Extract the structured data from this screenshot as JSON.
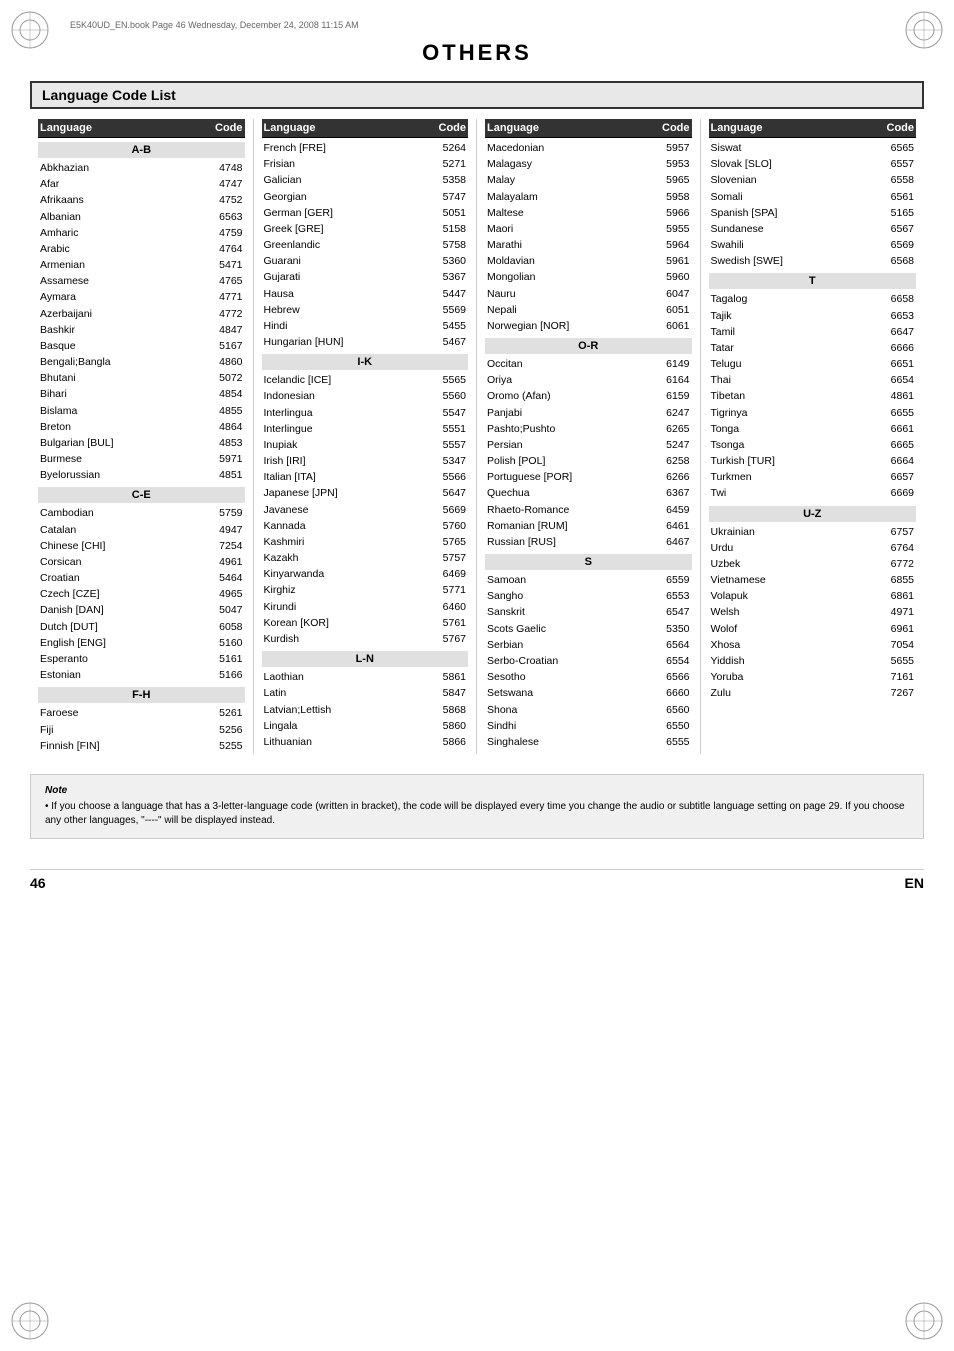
{
  "page": {
    "file_info": "E5K40UD_EN.book  Page 46  Wednesday, December 24, 2008  11:15 AM",
    "title": "OTHERS",
    "section_title": "Language Code List",
    "page_number": "46",
    "page_lang": "EN"
  },
  "columns": [
    {
      "header_lang": "Language",
      "header_code": "Code",
      "sections": [
        {
          "heading": "A-B",
          "entries": [
            {
              "lang": "Abkhazian",
              "code": "4748"
            },
            {
              "lang": "Afar",
              "code": "4747"
            },
            {
              "lang": "Afrikaans",
              "code": "4752"
            },
            {
              "lang": "Albanian",
              "code": "6563"
            },
            {
              "lang": "Amharic",
              "code": "4759"
            },
            {
              "lang": "Arabic",
              "code": "4764"
            },
            {
              "lang": "Armenian",
              "code": "5471"
            },
            {
              "lang": "Assamese",
              "code": "4765"
            },
            {
              "lang": "Aymara",
              "code": "4771"
            },
            {
              "lang": "Azerbaijani",
              "code": "4772"
            },
            {
              "lang": "Bashkir",
              "code": "4847"
            },
            {
              "lang": "Basque",
              "code": "5167"
            },
            {
              "lang": "Bengali;Bangla",
              "code": "4860"
            },
            {
              "lang": "Bhutani",
              "code": "5072"
            },
            {
              "lang": "Bihari",
              "code": "4854"
            },
            {
              "lang": "Bislama",
              "code": "4855"
            },
            {
              "lang": "Breton",
              "code": "4864"
            },
            {
              "lang": "Bulgarian [BUL]",
              "code": "4853"
            },
            {
              "lang": "Burmese",
              "code": "5971"
            },
            {
              "lang": "Byelorussian",
              "code": "4851"
            }
          ]
        },
        {
          "heading": "C-E",
          "entries": [
            {
              "lang": "Cambodian",
              "code": "5759"
            },
            {
              "lang": "Catalan",
              "code": "4947"
            },
            {
              "lang": "Chinese [CHI]",
              "code": "7254"
            },
            {
              "lang": "Corsican",
              "code": "4961"
            },
            {
              "lang": "Croatian",
              "code": "5464"
            },
            {
              "lang": "Czech [CZE]",
              "code": "4965"
            },
            {
              "lang": "Danish [DAN]",
              "code": "5047"
            },
            {
              "lang": "Dutch [DUT]",
              "code": "6058"
            },
            {
              "lang": "English [ENG]",
              "code": "5160"
            },
            {
              "lang": "Esperanto",
              "code": "5161"
            },
            {
              "lang": "Estonian",
              "code": "5166"
            }
          ]
        },
        {
          "heading": "F-H",
          "entries": [
            {
              "lang": "Faroese",
              "code": "5261"
            },
            {
              "lang": "Fiji",
              "code": "5256"
            },
            {
              "lang": "Finnish [FIN]",
              "code": "5255"
            }
          ]
        }
      ]
    },
    {
      "header_lang": "Language",
      "header_code": "Code",
      "sections": [
        {
          "heading": "",
          "entries": [
            {
              "lang": "French [FRE]",
              "code": "5264"
            },
            {
              "lang": "Frisian",
              "code": "5271"
            },
            {
              "lang": "Galician",
              "code": "5358"
            },
            {
              "lang": "Georgian",
              "code": "5747"
            },
            {
              "lang": "German [GER]",
              "code": "5051"
            },
            {
              "lang": "Greek [GRE]",
              "code": "5158"
            },
            {
              "lang": "Greenlandic",
              "code": "5758"
            },
            {
              "lang": "Guarani",
              "code": "5360"
            },
            {
              "lang": "Gujarati",
              "code": "5367"
            },
            {
              "lang": "Hausa",
              "code": "5447"
            },
            {
              "lang": "Hebrew",
              "code": "5569"
            },
            {
              "lang": "Hindi",
              "code": "5455"
            },
            {
              "lang": "Hungarian [HUN]",
              "code": "5467"
            }
          ]
        },
        {
          "heading": "I-K",
          "entries": [
            {
              "lang": "Icelandic [ICE]",
              "code": "5565"
            },
            {
              "lang": "Indonesian",
              "code": "5560"
            },
            {
              "lang": "Interlingua",
              "code": "5547"
            },
            {
              "lang": "Interlingue",
              "code": "5551"
            },
            {
              "lang": "Inupiak",
              "code": "5557"
            },
            {
              "lang": "Irish [IRI]",
              "code": "5347"
            },
            {
              "lang": "Italian [ITA]",
              "code": "5566"
            },
            {
              "lang": "Japanese [JPN]",
              "code": "5647"
            },
            {
              "lang": "Javanese",
              "code": "5669"
            },
            {
              "lang": "Kannada",
              "code": "5760"
            },
            {
              "lang": "Kashmiri",
              "code": "5765"
            },
            {
              "lang": "Kazakh",
              "code": "5757"
            },
            {
              "lang": "Kinyarwanda",
              "code": "6469"
            },
            {
              "lang": "Kirghiz",
              "code": "5771"
            },
            {
              "lang": "Kirundi",
              "code": "6460"
            },
            {
              "lang": "Korean [KOR]",
              "code": "5761"
            },
            {
              "lang": "Kurdish",
              "code": "5767"
            }
          ]
        },
        {
          "heading": "L-N",
          "entries": [
            {
              "lang": "Laothian",
              "code": "5861"
            },
            {
              "lang": "Latin",
              "code": "5847"
            },
            {
              "lang": "Latvian;Lettish",
              "code": "5868"
            },
            {
              "lang": "Lingala",
              "code": "5860"
            },
            {
              "lang": "Lithuanian",
              "code": "5866"
            }
          ]
        }
      ]
    },
    {
      "header_lang": "Language",
      "header_code": "Code",
      "sections": [
        {
          "heading": "",
          "entries": [
            {
              "lang": "Macedonian",
              "code": "5957"
            },
            {
              "lang": "Malagasy",
              "code": "5953"
            },
            {
              "lang": "Malay",
              "code": "5965"
            },
            {
              "lang": "Malayalam",
              "code": "5958"
            },
            {
              "lang": "Maltese",
              "code": "5966"
            },
            {
              "lang": "Maori",
              "code": "5955"
            },
            {
              "lang": "Marathi",
              "code": "5964"
            },
            {
              "lang": "Moldavian",
              "code": "5961"
            },
            {
              "lang": "Mongolian",
              "code": "5960"
            },
            {
              "lang": "Nauru",
              "code": "6047"
            },
            {
              "lang": "Nepali",
              "code": "6051"
            },
            {
              "lang": "Norwegian [NOR]",
              "code": "6061"
            }
          ]
        },
        {
          "heading": "O-R",
          "entries": [
            {
              "lang": "Occitan",
              "code": "6149"
            },
            {
              "lang": "Oriya",
              "code": "6164"
            },
            {
              "lang": "Oromo (Afan)",
              "code": "6159"
            },
            {
              "lang": "Panjabi",
              "code": "6247"
            },
            {
              "lang": "Pashto;Pushto",
              "code": "6265"
            },
            {
              "lang": "Persian",
              "code": "5247"
            },
            {
              "lang": "Polish [POL]",
              "code": "6258"
            },
            {
              "lang": "Portuguese [POR]",
              "code": "6266"
            },
            {
              "lang": "Quechua",
              "code": "6367"
            },
            {
              "lang": "Rhaeto-Romance",
              "code": "6459"
            },
            {
              "lang": "Romanian [RUM]",
              "code": "6461"
            },
            {
              "lang": "Russian [RUS]",
              "code": "6467"
            }
          ]
        },
        {
          "heading": "S",
          "entries": [
            {
              "lang": "Samoan",
              "code": "6559"
            },
            {
              "lang": "Sangho",
              "code": "6553"
            },
            {
              "lang": "Sanskrit",
              "code": "6547"
            },
            {
              "lang": "Scots Gaelic",
              "code": "5350"
            },
            {
              "lang": "Serbian",
              "code": "6564"
            },
            {
              "lang": "Serbo-Croatian",
              "code": "6554"
            },
            {
              "lang": "Sesotho",
              "code": "6566"
            },
            {
              "lang": "Setswana",
              "code": "6660"
            },
            {
              "lang": "Shona",
              "code": "6560"
            },
            {
              "lang": "Sindhi",
              "code": "6550"
            },
            {
              "lang": "Singhalese",
              "code": "6555"
            }
          ]
        }
      ]
    },
    {
      "header_lang": "Language",
      "header_code": "Code",
      "sections": [
        {
          "heading": "",
          "entries": [
            {
              "lang": "Siswat",
              "code": "6565"
            },
            {
              "lang": "Slovak [SLO]",
              "code": "6557"
            },
            {
              "lang": "Slovenian",
              "code": "6558"
            },
            {
              "lang": "Somali",
              "code": "6561"
            },
            {
              "lang": "Spanish [SPA]",
              "code": "5165"
            },
            {
              "lang": "Sundanese",
              "code": "6567"
            },
            {
              "lang": "Swahili",
              "code": "6569"
            },
            {
              "lang": "Swedish [SWE]",
              "code": "6568"
            }
          ]
        },
        {
          "heading": "T",
          "entries": [
            {
              "lang": "Tagalog",
              "code": "6658"
            },
            {
              "lang": "Tajik",
              "code": "6653"
            },
            {
              "lang": "Tamil",
              "code": "6647"
            },
            {
              "lang": "Tatar",
              "code": "6666"
            },
            {
              "lang": "Telugu",
              "code": "6651"
            },
            {
              "lang": "Thai",
              "code": "6654"
            },
            {
              "lang": "Tibetan",
              "code": "4861"
            },
            {
              "lang": "Tigrinya",
              "code": "6655"
            },
            {
              "lang": "Tonga",
              "code": "6661"
            },
            {
              "lang": "Tsonga",
              "code": "6665"
            },
            {
              "lang": "Turkish [TUR]",
              "code": "6664"
            },
            {
              "lang": "Turkmen",
              "code": "6657"
            },
            {
              "lang": "Twi",
              "code": "6669"
            }
          ]
        },
        {
          "heading": "U-Z",
          "entries": [
            {
              "lang": "Ukrainian",
              "code": "6757"
            },
            {
              "lang": "Urdu",
              "code": "6764"
            },
            {
              "lang": "Uzbek",
              "code": "6772"
            },
            {
              "lang": "Vietnamese",
              "code": "6855"
            },
            {
              "lang": "Volapuk",
              "code": "6861"
            },
            {
              "lang": "Welsh",
              "code": "4971"
            },
            {
              "lang": "Wolof",
              "code": "6961"
            },
            {
              "lang": "Xhosa",
              "code": "7054"
            },
            {
              "lang": "Yiddish",
              "code": "5655"
            },
            {
              "lang": "Yoruba",
              "code": "7161"
            },
            {
              "lang": "Zulu",
              "code": "7267"
            }
          ]
        }
      ]
    }
  ],
  "note": {
    "title": "Note",
    "content": "• If you choose a language that has a 3-letter-language code (written in bracket), the code will be displayed every time you change the audio or subtitle language setting on page 29. If you choose any other languages, \"----\" will be displayed instead."
  }
}
